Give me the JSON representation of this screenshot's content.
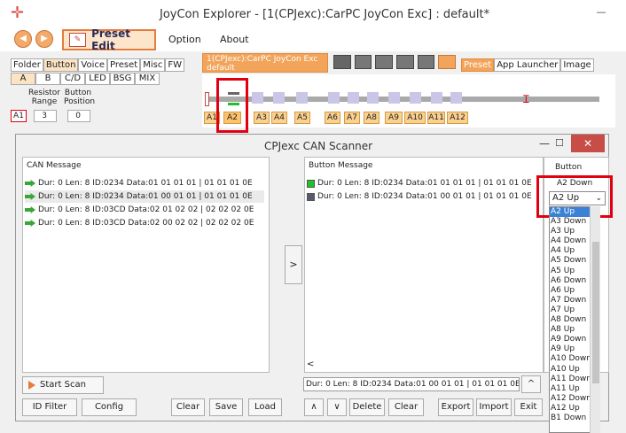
{
  "window": {
    "title": "JoyCon Explorer - [1(CPJexc):CarPC JoyCon Exc] : default*",
    "minimize_glyph": "—"
  },
  "toolbar": {
    "back_glyph": "◀",
    "forward_glyph": "▶",
    "preset_edit_label": "Preset Edit",
    "preset_edit_icon_glyph": "✎",
    "menu": [
      "Option",
      "About"
    ]
  },
  "left_tabs": [
    "Folder",
    "Button",
    "Voice",
    "Preset",
    "Misc",
    "FW"
  ],
  "device_tab": {
    "line1": "1(CPJexc):CarPC JoyCon Exc",
    "line2": "default"
  },
  "right_tabs": [
    "Preset",
    "App Launcher",
    "Image"
  ],
  "sub_tabs": [
    "A",
    "B",
    "C/D",
    "LED",
    "BSG",
    "MIX"
  ],
  "columns": {
    "resistor": "Resistor Range",
    "button": "Button Position"
  },
  "first_row": {
    "label": "A1",
    "range": "3",
    "position": "0"
  },
  "keys": [
    "A1",
    "A2",
    "A3",
    "A4",
    "A5",
    "A6",
    "A7",
    "A8",
    "A9",
    "A10",
    "A11",
    "A12"
  ],
  "dialog": {
    "title": "CPJexc CAN Scanner",
    "minimize_glyph": "—",
    "maximize_glyph": "☐",
    "close_glyph": "✕",
    "can_header": "CAN Message",
    "can_messages": [
      "Dur:  0 Len: 8 ID:0234 Data:01 01 01 01 | 01 01 01 0E",
      "Dur:  0 Len: 8 ID:0234 Data:01 00 01 01 | 01 01 01 0E",
      "Dur:  0 Len: 8 ID:03CD Data:02 01 02 02 | 02 02 02 0E",
      "Dur:  0 Len: 8 ID:03CD Data:02 00 02 02 | 02 02 02 0E"
    ],
    "button_header": "Button Message",
    "button_col_header": "Button",
    "button_messages": [
      {
        "text": "Dur:  0 Len: 8 ID:0234 Data:01 01 01 01 | 01 01 01 0E",
        "color": "#22c02a",
        "button": "A2 Down"
      },
      {
        "text": "Dur:  0 Len: 8 ID:0234 Data:01 00 01 01 | 01 01 01 0E",
        "color": "#555a6e",
        "button": "A2 Up"
      }
    ],
    "dropdown_value": "A2 Up",
    "dropdown_chevron": "⌄",
    "dropdown_options": [
      "A2 Up",
      "A3 Down",
      "A3 Up",
      "A4 Down",
      "A4 Up",
      "A5 Down",
      "A5 Up",
      "A6 Down",
      "A6 Up",
      "A7 Down",
      "A7 Up",
      "A8 Down",
      "A8 Up",
      "A9 Down",
      "A9 Up",
      "A10 Down",
      "A10 Up",
      "A11 Down",
      "A11 Up",
      "A12 Down",
      "A12 Up",
      "B1 Down"
    ],
    "middle_arrow": ">",
    "status_text": "Dur:  0 Len: 8 ID:0234 Data:01 00 01 01 | 01 01 01 0E",
    "start_scan": "Start Scan",
    "left_buttons": {
      "id_filter": "ID Filter",
      "config": "Config",
      "clear": "Clear",
      "save": "Save",
      "load": "Load"
    },
    "right_buttons": {
      "up": "∧",
      "down": "∨",
      "delete": "Delete",
      "clear": "Clear",
      "export": "Export",
      "import": "Import",
      "exit": "Exit"
    },
    "scroll_left": "<",
    "scroll_up": "^"
  },
  "colors": {
    "accent": "#e57c3b",
    "highlight": "#e00012",
    "selection": "#3b82d6"
  }
}
